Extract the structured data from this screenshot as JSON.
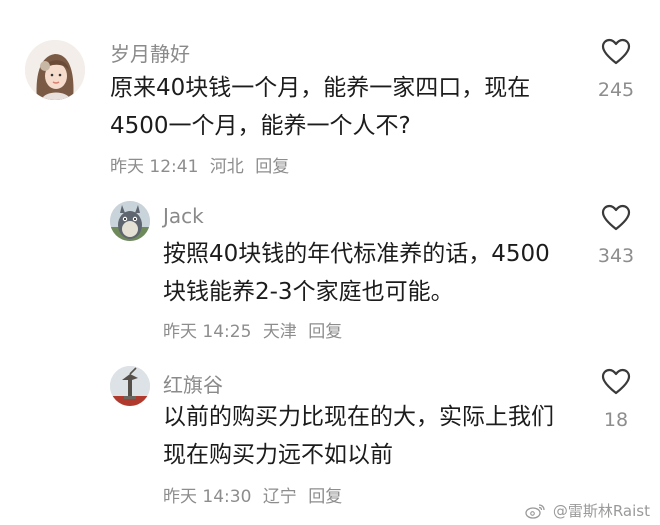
{
  "comments": [
    {
      "username": "岁月静好",
      "avatar": "avatar-girl-icon",
      "lines": [
        "原来40块钱一个月，能养一家四口，现在",
        "4500一个月，能养一个人不?"
      ],
      "time": "昨天 12:41",
      "location": "河北",
      "reply_label": "回复",
      "likes": "245"
    },
    {
      "username": "Jack",
      "avatar": "avatar-totoro-icon",
      "lines": [
        "按照40块钱的年代标准养的话，4500",
        "块钱能养2-3个家庭也可能。"
      ],
      "time": "昨天 14:25",
      "location": "天津",
      "reply_label": "回复",
      "likes": "343"
    },
    {
      "username": "红旗谷",
      "avatar": "avatar-monument-icon",
      "lines": [
        "以前的购买力比现在的大，实际上我们",
        "现在购买力远不如以前"
      ],
      "time": "昨天 14:30",
      "location": "辽宁",
      "reply_label": "回复",
      "likes": "18"
    }
  ],
  "watermark": {
    "text": "@雷斯林Raist",
    "icon": "weibo-logo-icon"
  },
  "colors": {
    "secondary_text": "#8d8d8d",
    "primary_text": "#1c1c1c",
    "background": "#ffffff"
  }
}
